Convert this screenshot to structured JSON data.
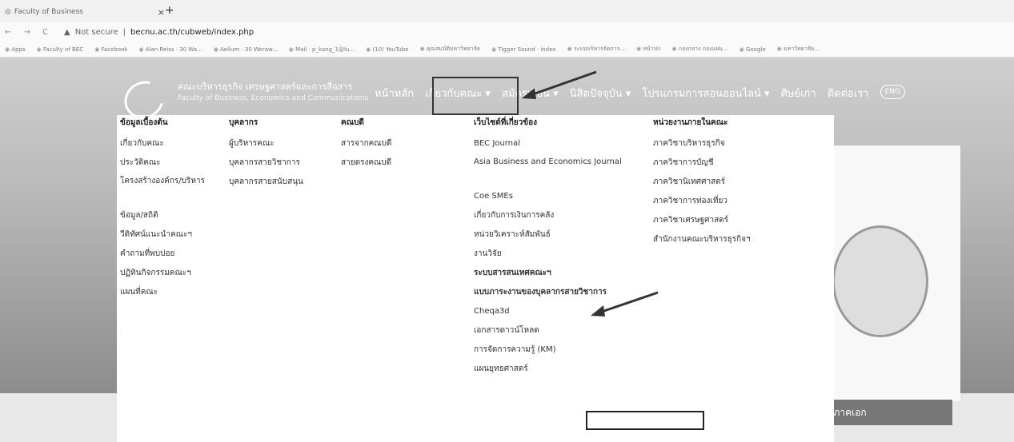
{
  "browser": {
    "tab_title": "Faculty of Business",
    "new_tab": "+",
    "close": "×",
    "nav_buttons": "← → C",
    "security": "Not secure",
    "url": "becnu.ac.th/cubweb/index.php",
    "bookmarks": [
      "Apps",
      "Faculty of BEC",
      "Facebook",
      "Alan Reiss · 30 Wa...",
      "Aelium · 30 Weraw...",
      "Mail · p_kang_1@lu...",
      "(10) YouTube",
      "คุณสมบัติมหาวิทยาลัย",
      "Tigger Sound · index",
      "ระบบบริหารจัดการ...",
      "หน้าปก",
      "กองกลาง กองแผน...",
      "Google",
      "มหาวิทยาลัย..."
    ]
  },
  "site": {
    "brand_line1": "คณะบริหารธุรกิจ เศรษฐศาสตร์และการสื่อสาร",
    "brand_line2": "Faculty of Business, Economics and Communications",
    "nav": [
      "หน้าหลัก",
      "เกี่ยวกับคณะ ▾",
      "สมัครเรียน ▾",
      "นิสิตปัจจุบัน ▾",
      "โปรแกรมการสอนออนไลน์ ▾",
      "ศิษย์เก่า",
      "ติดต่อเรา"
    ],
    "lang": "ENG",
    "more_button": "...ภาคเอก"
  },
  "menu": {
    "col1": {
      "header": "ข้อมูลเบื้องต้น",
      "items": [
        "เกี่ยวกับคณะ",
        "ประวัติคณะ",
        "โครงสร้างองค์กร/บริหาร",
        "ข้อมูล/สถิติ",
        "วีดิทัศน์แนะนำคณะฯ",
        "คำถามที่พบบ่อย",
        "ปฏิทินกิจกรรมคณะฯ",
        "แผนที่คณะ"
      ]
    },
    "col2": {
      "header": "บุคลากร",
      "items": [
        "ผู้บริหารคณะ",
        "บุคลากรสายวิชาการ",
        "บุคลากรสายสนับสนุน"
      ]
    },
    "col3": {
      "header": "คณบดี",
      "items": [
        "สารจากคณบดี",
        "สายตรงคณบดี"
      ]
    },
    "col4": {
      "header": "เว็บไซต์ที่เกี่ยวข้อง",
      "items": [
        "BEC Journal",
        "Asia Business and Economics Journal",
        "Coe SMEs",
        "เกี่ยวกับการเงินการคลัง",
        "หน่วยวิเคราะห์สัมพันธ์",
        "งานวิจัย",
        "ระบบสารสนเทศคณะฯ",
        "แบบภาระงานของบุคลากรสายวิชาการ",
        "Cheqa3d",
        "เอกสารดาวน์โหลด",
        "การจัดการความรู้ (KM)",
        "แผนยุทธศาสตร์"
      ]
    },
    "col5": {
      "header": "หน่วยงานภายในคณะ",
      "items": [
        "ภาควิชาบริหารธุรกิจ",
        "ภาควิชาการบัญชี",
        "ภาควิชานิเทศศาสตร์",
        "ภาควิชาการท่องเที่ยว",
        "ภาควิชาเศรษฐศาสตร์",
        "สำนักงานคณะบริหารธุรกิจฯ"
      ]
    }
  }
}
